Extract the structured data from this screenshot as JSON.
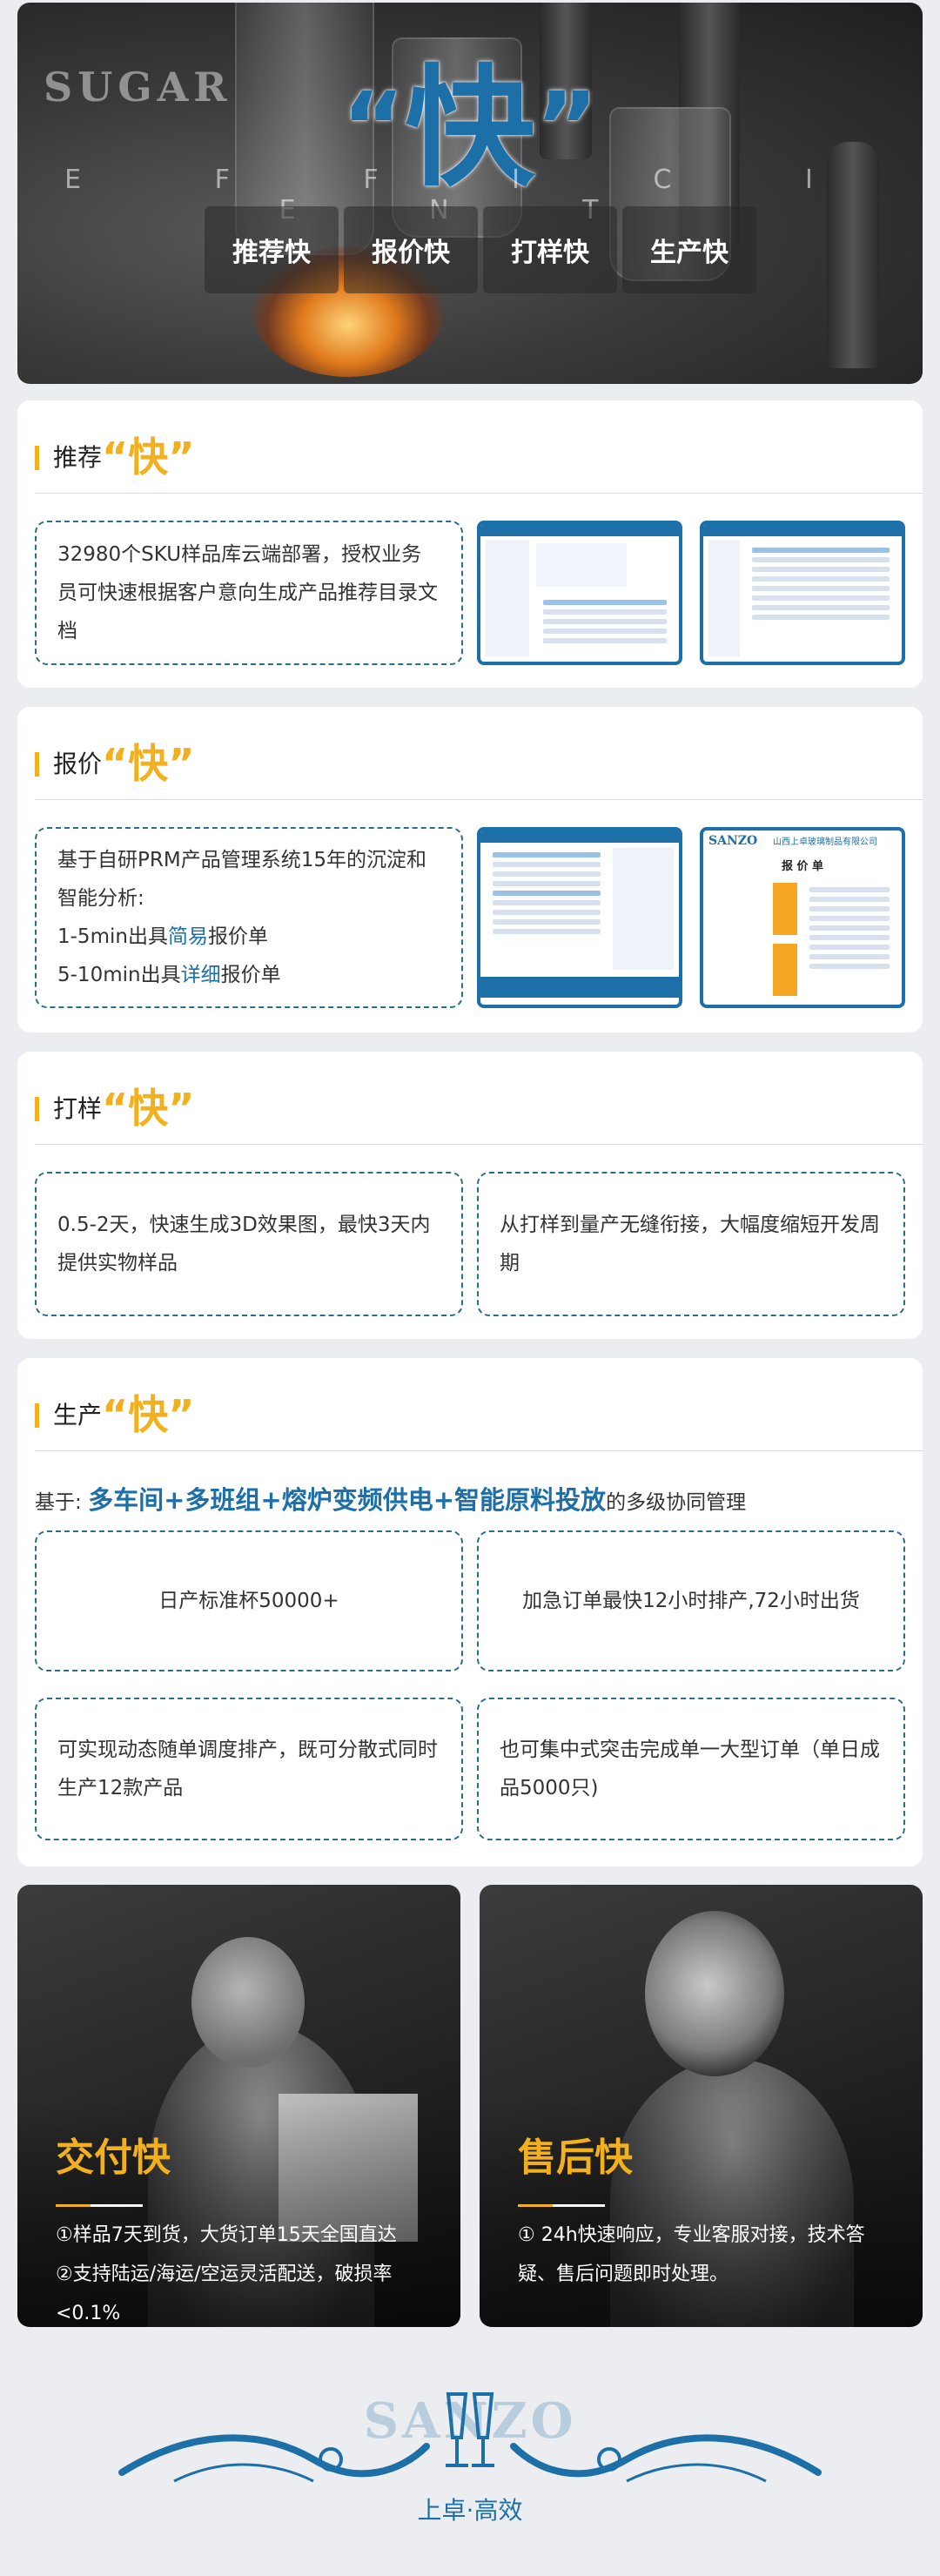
{
  "hero": {
    "backdrop_text": "SUGAR",
    "quote_open": "“",
    "quote_char": "快",
    "quote_close": "”",
    "subtitle": "E F F I C I E N T",
    "pills": [
      "推荐快",
      "报价快",
      "打样快",
      "生产快"
    ]
  },
  "sections": {
    "recommend": {
      "title": "推荐",
      "title_key": "“快”",
      "text": "32980个SKU样品库云端部署，授权业务员可快速根据客户意向生成产品推荐目录文档"
    },
    "quote": {
      "title": "报价",
      "title_key": "“快”",
      "line1": "基于自研PRM产品管理系统15年的沉淀和智能分析:",
      "line2_pre": "1-5min出具",
      "line2_hl": "简易",
      "line2_post": "报价单",
      "line3_pre": "5-10min出具",
      "line3_hl": "详细",
      "line3_post": "报价单",
      "thumb_company": "山西上卓玻璃制品有限公司",
      "thumb_doc": "报 价 单",
      "thumb_brand": "SANZO"
    },
    "sample": {
      "title": "打样",
      "title_key": "“快”",
      "box1": "0.5-2天，快速生成3D效果图，最快3天内提供实物样品",
      "box2": "从打样到量产无缝衔接，大幅度缩短开发周期"
    },
    "production": {
      "title": "生产",
      "title_key": "“快”",
      "basis_pre": "基于: ",
      "basis_hl1": "多车间",
      "basis_plus1": "+",
      "basis_hl2": "多班组",
      "basis_plus2": "+",
      "basis_hl3": "熔炉变频供电",
      "basis_plus3": "+",
      "basis_hl4": "智能原料投放",
      "basis_post": "的多级协同管理",
      "box1": "日产标准杯50000+",
      "box2": "加急订单最快12小时排产,72小时出货",
      "box3": "可实现动态随单调度排产，既可分散式同时生产12款产品",
      "box4": "也可集中式突击完成单一大型订单（单日成品5000只)"
    }
  },
  "delivery": {
    "title": "交付快",
    "line1": "①样品7天到货，大货订单15天全国直达",
    "line2": "②支持陆运/海运/空运灵活配送，破损率<0.1%"
  },
  "aftersales": {
    "title": "售后快",
    "text": "① 24h快速响应，专业客服对接，技术答疑、售后问题即时处理。"
  },
  "footer": {
    "brand": "SANZO",
    "slogan": "上卓·高效"
  },
  "colors": {
    "accent_blue": "#1d6fa8",
    "accent_gold": "#f2b01e",
    "dash_border": "#2a6f8a"
  }
}
